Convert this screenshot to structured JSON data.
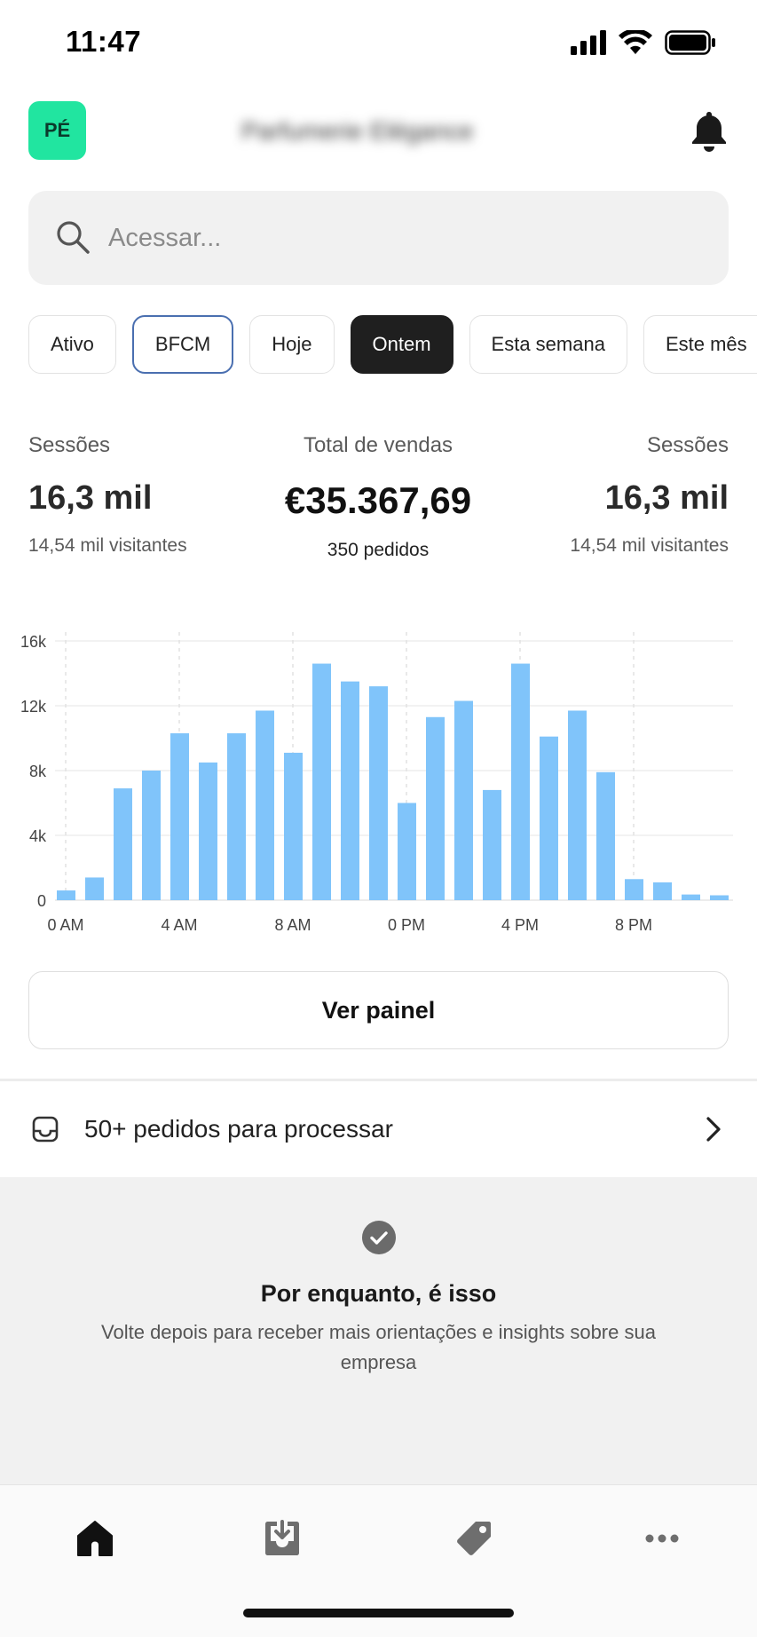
{
  "status_bar": {
    "time": "11:47"
  },
  "header": {
    "avatar_initials": "PÉ",
    "store_name": "Parfumerie Elégance"
  },
  "search": {
    "placeholder": "Acessar..."
  },
  "filters": [
    {
      "label": "Ativo",
      "state": "default"
    },
    {
      "label": "BFCM",
      "state": "outlined"
    },
    {
      "label": "Hoje",
      "state": "default"
    },
    {
      "label": "Ontem",
      "state": "selected"
    },
    {
      "label": "Esta semana",
      "state": "default"
    },
    {
      "label": "Este mês",
      "state": "default"
    }
  ],
  "metrics": {
    "left": {
      "label": "Sessões",
      "value": "16,3 mil",
      "sub": "14,54 mil visitantes"
    },
    "center": {
      "label": "Total de vendas",
      "value": "€35.367,69",
      "sub": "350 pedidos"
    },
    "right": {
      "label": "Sessões",
      "value": "16,3 mil",
      "sub": "14,54 mil visitantes"
    }
  },
  "chart_data": {
    "type": "bar",
    "color": "#80c4fa",
    "x_tick_labels": [
      "0 AM",
      "4 AM",
      "8 AM",
      "0 PM",
      "4 PM",
      "8 PM"
    ],
    "y_tick_labels": [
      "0",
      "4k",
      "8k",
      "12k",
      "16k"
    ],
    "ylim": [
      0,
      16000
    ],
    "categories": [
      0,
      1,
      2,
      3,
      4,
      5,
      6,
      7,
      8,
      9,
      10,
      11,
      12,
      13,
      14,
      15,
      16,
      17,
      18,
      19,
      20,
      21,
      22,
      23
    ],
    "values": [
      600,
      1400,
      6900,
      8000,
      10300,
      8500,
      10300,
      11700,
      9100,
      14600,
      13500,
      13200,
      6000,
      11300,
      12300,
      6800,
      14600,
      10100,
      11700,
      7900,
      1300,
      1100,
      350,
      300
    ],
    "grid": true
  },
  "view_button": {
    "label": "Ver painel"
  },
  "orders": {
    "label": "50+ pedidos para processar"
  },
  "empty_state": {
    "title": "Por enquanto, é isso",
    "body": "Volte depois para receber mais orientações e insights sobre sua empresa"
  },
  "tabs": [
    {
      "icon": "home-icon",
      "active": true
    },
    {
      "icon": "inbox-download-icon",
      "active": false
    },
    {
      "icon": "tag-icon",
      "active": false
    },
    {
      "icon": "more-icon",
      "active": false
    }
  ]
}
